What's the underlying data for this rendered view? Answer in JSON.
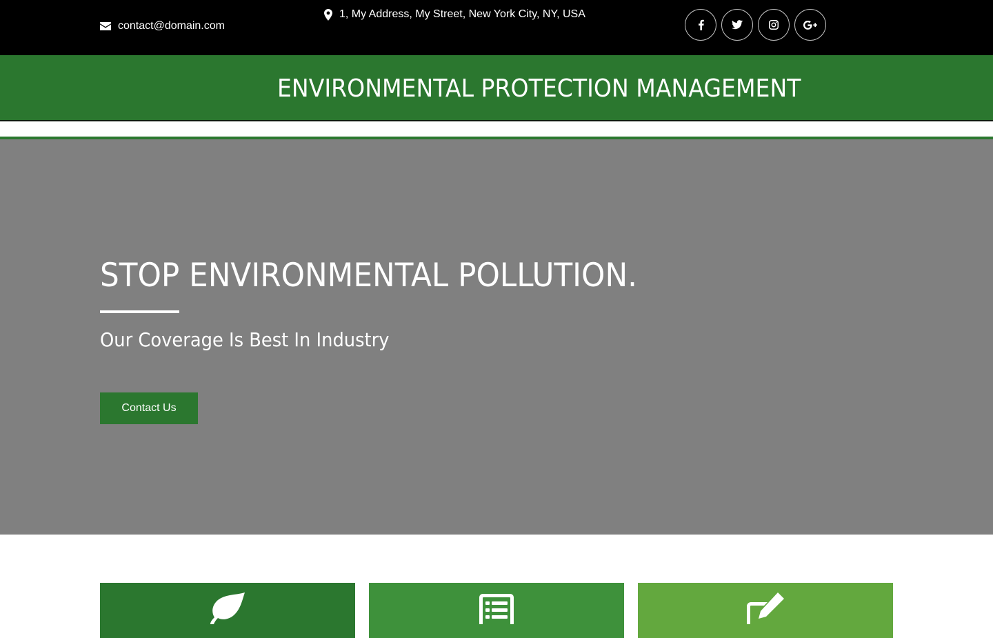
{
  "topbar": {
    "email": "contact@domain.com",
    "email_icon": "envelope-icon",
    "address": "1, My Address, My Street, New York City, NY, USA",
    "address_icon": "map-marker-icon",
    "social": [
      {
        "icon": "facebook-icon"
      },
      {
        "icon": "twitter-icon"
      },
      {
        "icon": "instagram-icon"
      },
      {
        "icon": "google-plus-icon"
      }
    ]
  },
  "header": {
    "title": "ENVIRONMENTAL PROTECTION MANAGEMENT"
  },
  "hero": {
    "heading": "STOP ENVIRONMENTAL POLLUTION.",
    "subheading": "Our Coverage Is Best In Industry",
    "button_label": "Contact Us"
  },
  "features": [
    {
      "icon": "leaf-icon"
    },
    {
      "icon": "list-icon"
    },
    {
      "icon": "edit-icon"
    }
  ],
  "colors": {
    "topbar_bg": "#000000",
    "brand_green": "#2b772f",
    "hero_bg": "#808080",
    "card_green_2": "#3e913b",
    "card_green_3": "#63a83e"
  }
}
